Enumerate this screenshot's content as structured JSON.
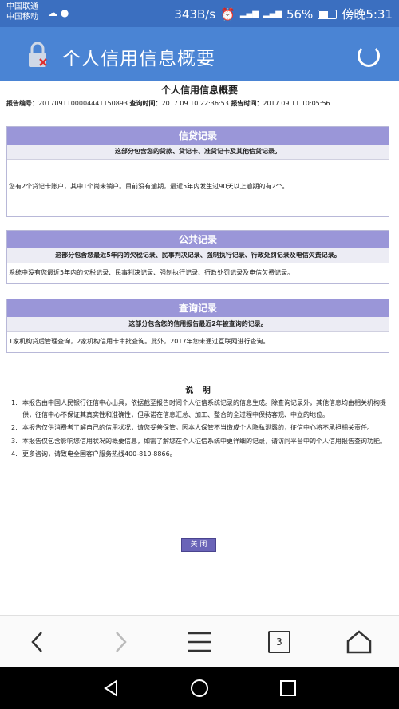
{
  "status": {
    "carrier1": "中国联通",
    "carrier2": "中国移动",
    "speed": "343B/s",
    "battery": "56%",
    "time": "傍晚5:31"
  },
  "appbar": {
    "title": "个人信用信息概要"
  },
  "report": {
    "title": "个人信用信息概要",
    "id_label": "报告编号：",
    "id_value": "2017091100004441150893",
    "query_label": "查询时间：",
    "query_value": "2017.09.10 22:36:53",
    "report_label": "报告时间：",
    "report_value": "2017.09.11 10:05:56"
  },
  "sections": {
    "credit": {
      "header": "信贷记录",
      "subtitle": "这部分包含您的贷款、贷记卡、准贷记卡及其他信贷记录。",
      "body": "您有2个贷记卡账户，其中1个尚未销户。目前没有逾期，最近5年内发生过90天以上逾期的有2个。"
    },
    "public": {
      "header": "公共记录",
      "subtitle": "这部分包含您最近5年内的欠税记录、民事判决记录、强制执行记录、行政处罚记录及电信欠费记录。",
      "body": "系统中没有您最近5年内的欠税记录、民事判决记录、强制执行记录、行政处罚记录及电信欠费记录。"
    },
    "inquiry": {
      "header": "查询记录",
      "subtitle": "这部分包含您的信用报告最近2年被查询的记录。",
      "body": "1家机构贷后管理查询，2家机构信用卡审批查询。此外，2017年您未通过互联网进行查询。"
    }
  },
  "notes": {
    "title": "说 明",
    "items": [
      {
        "num": "1.",
        "text": "本报告由中国人民银行征信中心出具，依据截至报告时间个人征信系统记录的信息生成。除查询记录外，其他信息均由相关机构提供，征信中心不保证其真实性和准确性，但承诺在信息汇总、加工、整合的全过程中保持客观、中立的地位。"
      },
      {
        "num": "2.",
        "text": "本报告仅供消费者了解自己的信用状况，请您妥善保管。因本人保管不当造成个人隐私泄露的，征信中心将不承担相关责任。"
      },
      {
        "num": "3.",
        "text": "本报告仅包含影响您信用状况的概要信息，如需了解您在个人征信系统中更详细的记录，请访问平台中的个人信用报告查询功能。"
      },
      {
        "num": "4.",
        "text": "更多咨询，请致电全国客户服务热线400-810-8866。"
      }
    ]
  },
  "close_label": "关 闭",
  "browser": {
    "tab_count": "3"
  }
}
